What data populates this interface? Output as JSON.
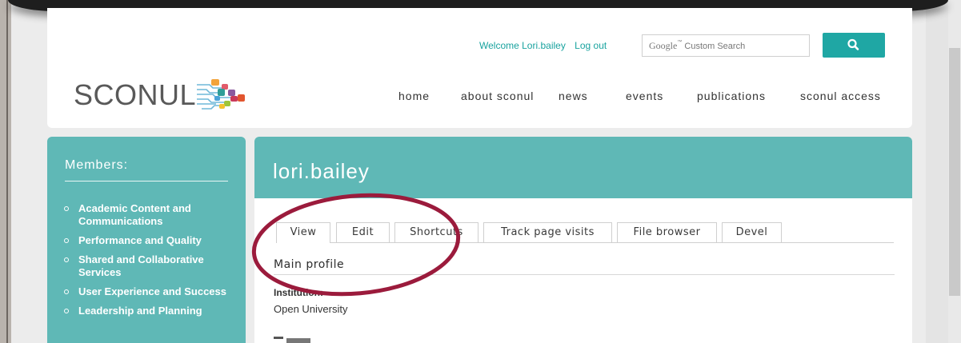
{
  "header": {
    "welcome_text": "Welcome Lori.bailey",
    "logout_label": "Log out",
    "search": {
      "brand": "Google",
      "tm": "™",
      "placeholder": "Custom Search"
    },
    "logo_text": "SCONUL",
    "nav": [
      {
        "label": "home"
      },
      {
        "label": "about sconul"
      },
      {
        "label": "news"
      },
      {
        "label": "events"
      },
      {
        "label": "publications"
      },
      {
        "label": "sconul access"
      }
    ]
  },
  "sidebar": {
    "title": "Members:",
    "items": [
      {
        "label": "Academic Content and Communications"
      },
      {
        "label": "Performance and Quality"
      },
      {
        "label": "Shared and Collaborative Services"
      },
      {
        "label": "User Experience and Success"
      },
      {
        "label": "Leadership and Planning"
      }
    ]
  },
  "main": {
    "page_title": "lori.bailey",
    "tabs": [
      {
        "label": "View"
      },
      {
        "label": "Edit"
      },
      {
        "label": "Shortcuts"
      },
      {
        "label": "Track page visits"
      },
      {
        "label": "File browser"
      },
      {
        "label": "Devel"
      }
    ],
    "section_title": "Main profile",
    "field_label": "Institution:",
    "field_value": "Open University"
  },
  "colors": {
    "teal": "#5fb8b6",
    "teal_button": "#1fa7a4",
    "link": "#19a39f",
    "annotation": "#9b1b3c"
  }
}
